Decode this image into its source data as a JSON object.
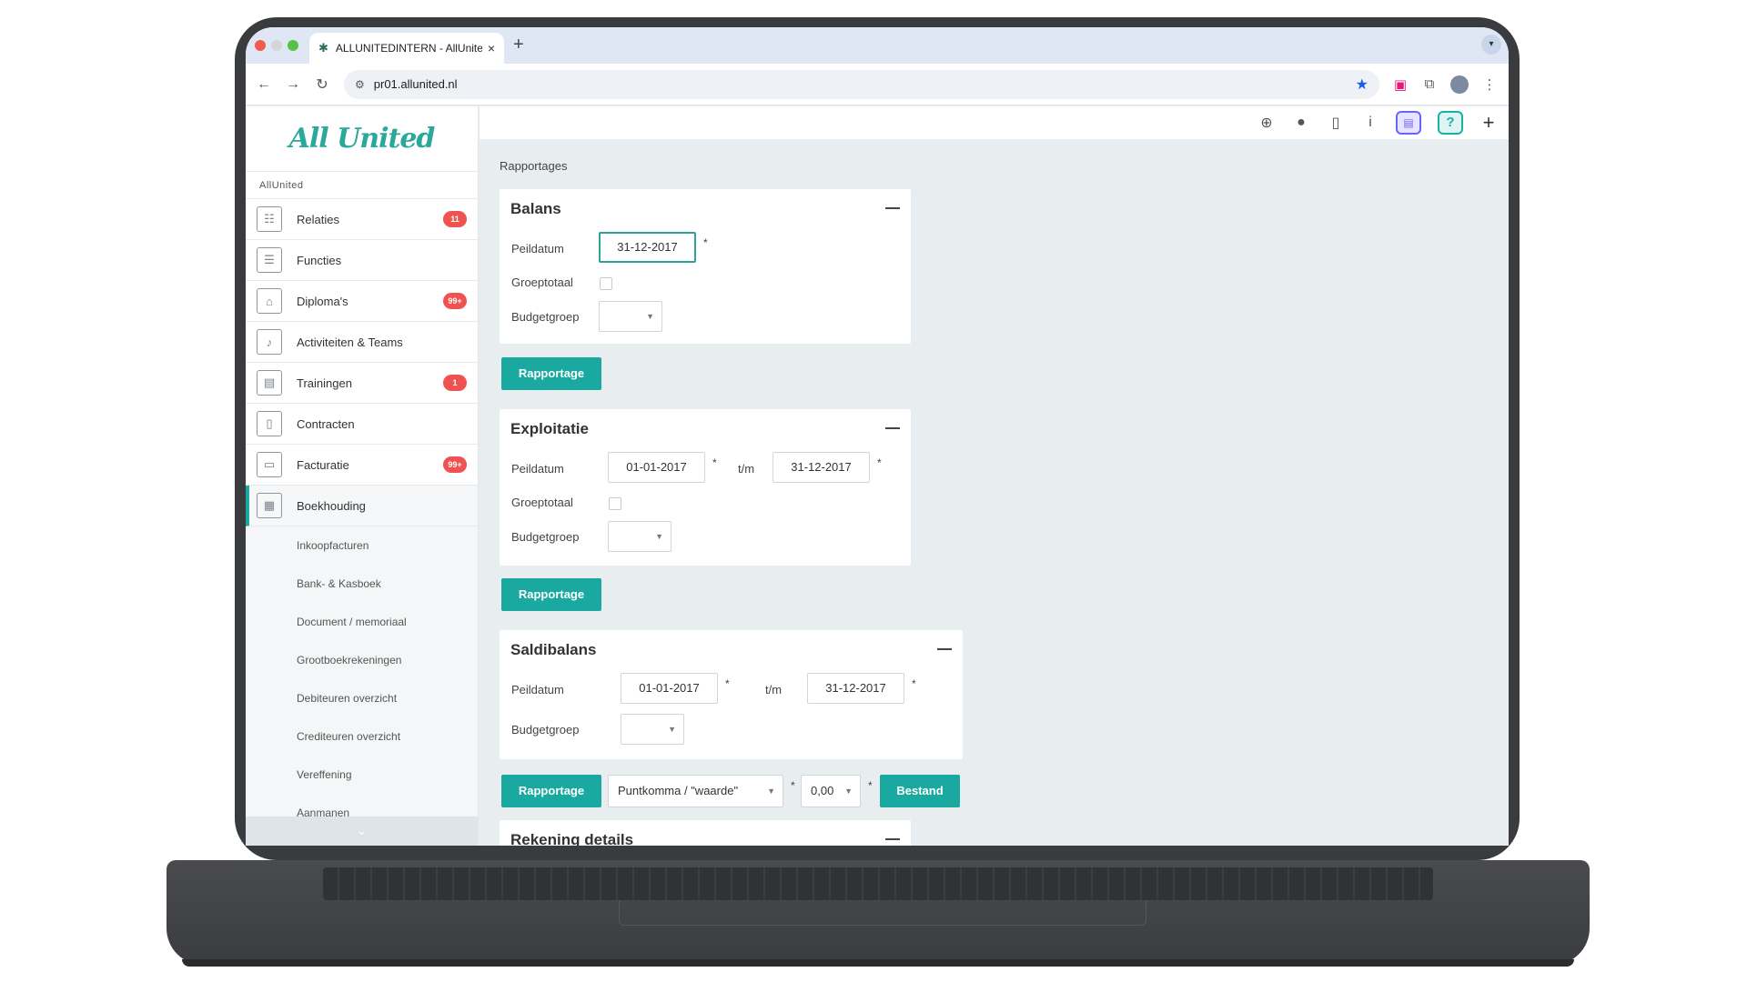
{
  "browser": {
    "tab_title": "ALLUNITEDINTERN - AllUnited",
    "tab_close": "×",
    "new_tab": "+",
    "url": "pr01.allunited.nl"
  },
  "sidebar": {
    "logo": "All United",
    "org_label": "AllUnited",
    "items": [
      {
        "label": "Relaties",
        "badge": "11"
      },
      {
        "label": "Functies",
        "badge": ""
      },
      {
        "label": "Diploma's",
        "badge": "99+"
      },
      {
        "label": "Activiteiten & Teams",
        "badge": ""
      },
      {
        "label": "Trainingen",
        "badge": "1"
      },
      {
        "label": "Contracten",
        "badge": ""
      },
      {
        "label": "Facturatie",
        "badge": "99+"
      },
      {
        "label": "Boekhouding",
        "badge": ""
      }
    ],
    "sub_items": [
      "Inkoopfacturen",
      "Bank- & Kasboek",
      "Document / memoriaal",
      "Grootboekrekeningen",
      "Debiteuren overzicht",
      "Crediteuren overzicht",
      "Vereffening",
      "Aanmanen"
    ]
  },
  "content": {
    "breadcrumb": "Rapportages",
    "balans": {
      "title": "Balans",
      "peildatum_label": "Peildatum",
      "peildatum_value": "31-12-2017",
      "groeptotaal_label": "Groeptotaal",
      "budgetgroep_label": "Budgetgroep",
      "button": "Rapportage"
    },
    "exploitatie": {
      "title": "Exploitatie",
      "peildatum_label": "Peildatum",
      "from_value": "01-01-2017",
      "tm_label": "t/m",
      "to_value": "31-12-2017",
      "groeptotaal_label": "Groeptotaal",
      "budgetgroep_label": "Budgetgroep",
      "button": "Rapportage"
    },
    "saldibalans": {
      "title": "Saldibalans",
      "peildatum_label": "Peildatum",
      "from_value": "01-01-2017",
      "tm_label": "t/m",
      "to_value": "31-12-2017",
      "budgetgroep_label": "Budgetgroep",
      "button": "Rapportage",
      "format_select": "Puntkomma / \"waarde\"",
      "decimal_select": "0,00",
      "file_button": "Bestand"
    },
    "rekening_details": {
      "title": "Rekening details"
    },
    "required_mark": "*"
  },
  "colors": {
    "accent": "#1aa9a0",
    "badge": "#ef5350",
    "page_bg": "#e8edf0"
  }
}
